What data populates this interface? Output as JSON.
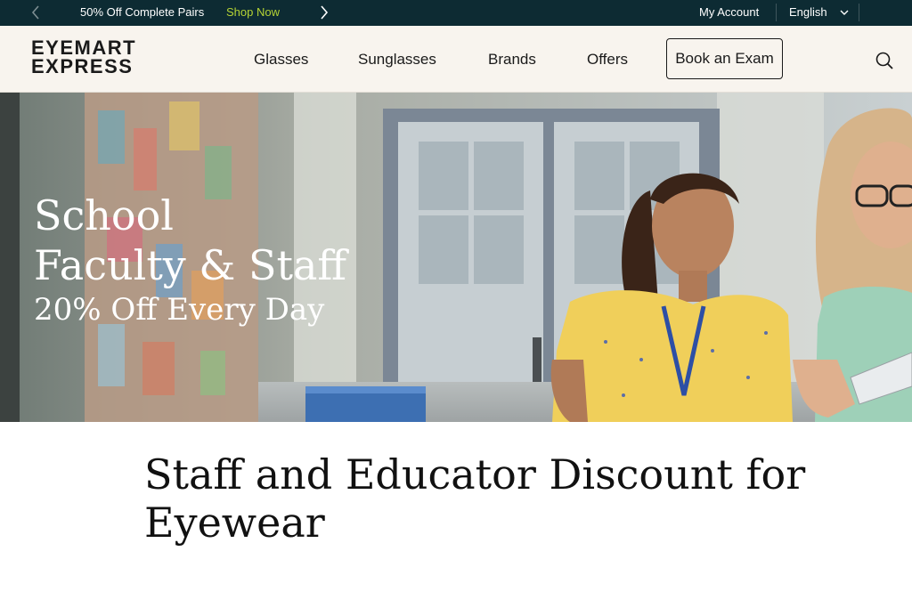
{
  "promo": {
    "text": "50% Off Complete Pairs",
    "link": "Shop Now",
    "prev_icon": "chevron-left-icon",
    "next_icon": "chevron-right-icon",
    "link_color": "#b5d334",
    "background": "#0d2b33"
  },
  "account": {
    "label": "My Account"
  },
  "language": {
    "selected": "English",
    "icon": "chevron-down-icon"
  },
  "logo": {
    "line1": "EYEMART",
    "line2": "EXPRESS"
  },
  "nav": {
    "items": [
      {
        "label": "Glasses"
      },
      {
        "label": "Sunglasses"
      },
      {
        "label": "Brands"
      },
      {
        "label": "Offers"
      }
    ],
    "book_exam": "Book an Exam",
    "search_icon": "search-icon"
  },
  "hero": {
    "line1": "School",
    "line2": "Faculty & Staff",
    "line3": "20% Off Every Day"
  },
  "page": {
    "heading": "Staff and Educator Discount for Eyewear"
  }
}
